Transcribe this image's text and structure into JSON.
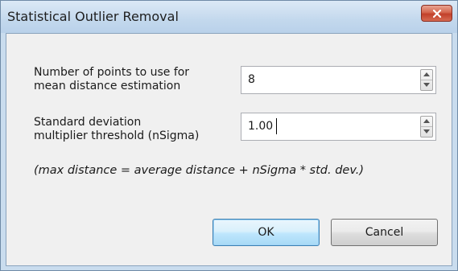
{
  "window": {
    "title": "Statistical Outlier Removal"
  },
  "fields": [
    {
      "label_line1": "Number of points to use for",
      "label_line2": "mean distance estimation",
      "value": "8"
    },
    {
      "label_line1": "Standard deviation",
      "label_line2": "multiplier threshold (nSigma)",
      "value": "1.00"
    }
  ],
  "note": "(max distance = average distance + nSigma * std. dev.)",
  "buttons": {
    "ok": "OK",
    "cancel": "Cancel"
  },
  "icons": {
    "close": "close-icon",
    "spin_up": "spin-up-arrow-icon",
    "spin_down": "spin-down-arrow-icon"
  },
  "colors": {
    "titlebar": "#c3d8ed",
    "close_button": "#c2402a",
    "ok_button_accent": "#3c7fb1"
  }
}
